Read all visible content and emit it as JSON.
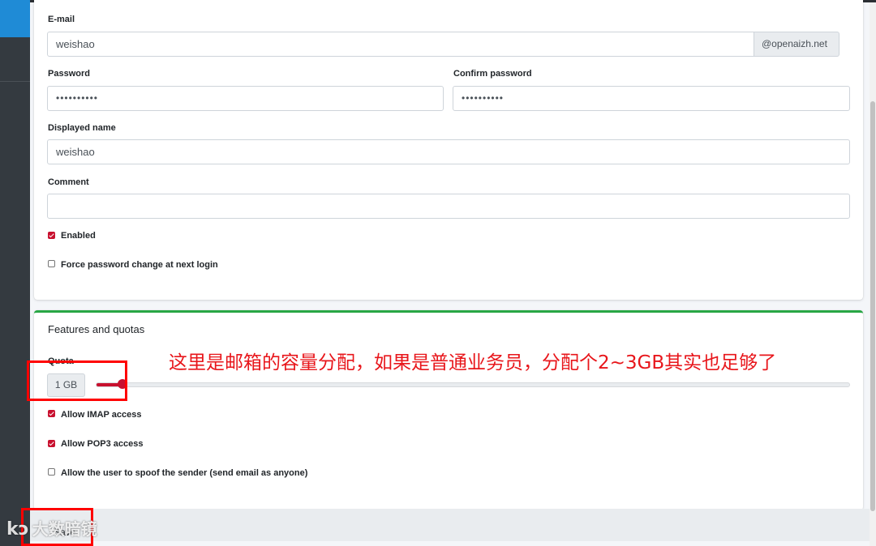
{
  "form": {
    "email": {
      "label": "E-mail",
      "value": "weishao",
      "domain": "@openaizh.net"
    },
    "password": {
      "label": "Password",
      "value": "••••••••••"
    },
    "confirm_password": {
      "label": "Confirm password",
      "value": "••••••••••"
    },
    "displayed_name": {
      "label": "Displayed name",
      "value": "weishao"
    },
    "comment": {
      "label": "Comment",
      "value": ""
    },
    "enabled": {
      "label": "Enabled",
      "checked": true
    },
    "force_password_change": {
      "label": "Force password change at next login",
      "checked": false
    }
  },
  "features": {
    "title": "Features and quotas",
    "quota": {
      "label": "Quota",
      "value_label": "1 GB",
      "level_fraction": 0.035
    },
    "allow_imap": {
      "label": "Allow IMAP access",
      "checked": true
    },
    "allow_pop3": {
      "label": "Allow POP3 access",
      "checked": true
    },
    "allow_spoof": {
      "label": "Allow the user to spoof the sender (send email as anyone)",
      "checked": false
    }
  },
  "annotation": {
    "text": "这里是邮箱的容量分配，如果是普通业务员，分配个2~3GB其实也足够了"
  },
  "footer": {
    "save_label": "Save"
  },
  "watermark": {
    "text": "大数暗镜"
  },
  "colors": {
    "accent": "#c8102e",
    "card_border_success": "#28a745",
    "annotation": "#ff0000",
    "sidebar_active": "#1f8bd6"
  }
}
